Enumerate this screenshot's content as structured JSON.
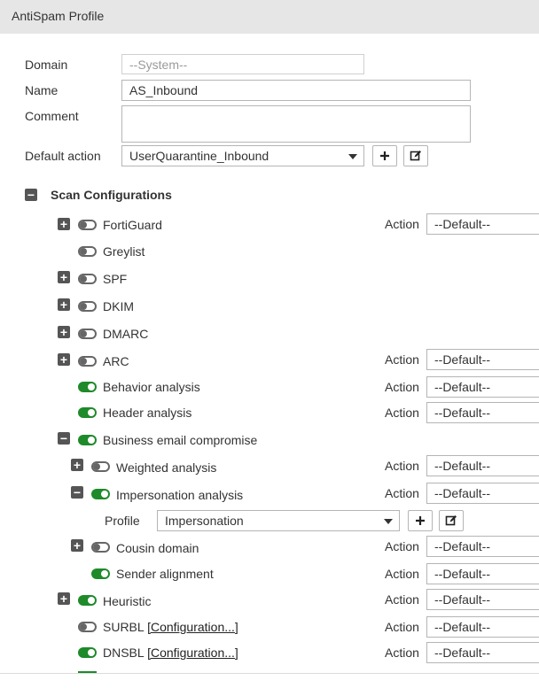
{
  "window": {
    "title": "AntiSpam Profile"
  },
  "form": {
    "domain_label": "Domain",
    "domain_value": "--System--",
    "name_label": "Name",
    "name_value": "AS_Inbound",
    "comment_label": "Comment",
    "comment_value": "",
    "default_action_label": "Default action",
    "default_action_value": "UserQuarantine_Inbound"
  },
  "section": {
    "title": "Scan Configurations",
    "action_label": "Action",
    "default_option": "--Default--"
  },
  "rows": [
    {
      "label": "FortiGuard",
      "enabled": false,
      "expander": "plus",
      "has_action": true
    },
    {
      "label": "Greylist",
      "enabled": false,
      "expander": "none",
      "has_action": false
    },
    {
      "label": "SPF",
      "enabled": false,
      "expander": "plus",
      "has_action": false
    },
    {
      "label": "DKIM",
      "enabled": false,
      "expander": "plus",
      "has_action": false
    },
    {
      "label": "DMARC",
      "enabled": false,
      "expander": "plus",
      "has_action": false
    },
    {
      "label": "ARC",
      "enabled": false,
      "expander": "plus",
      "has_action": true
    },
    {
      "label": "Behavior analysis",
      "enabled": true,
      "expander": "none",
      "has_action": true
    },
    {
      "label": "Header analysis",
      "enabled": true,
      "expander": "none",
      "has_action": true
    },
    {
      "label": "Business email compromise",
      "enabled": true,
      "expander": "minus",
      "has_action": false
    },
    {
      "label": "Weighted analysis",
      "enabled": false,
      "expander": "plus",
      "has_action": true
    },
    {
      "label": "Impersonation analysis",
      "enabled": true,
      "expander": "minus",
      "has_action": true
    },
    {
      "label": "Cousin domain",
      "enabled": false,
      "expander": "plus",
      "has_action": true
    },
    {
      "label": "Sender alignment",
      "enabled": true,
      "expander": "none",
      "has_action": true
    },
    {
      "label": "Heuristic",
      "enabled": true,
      "expander": "plus",
      "has_action": true
    },
    {
      "label": "SURBL",
      "link": "[Configuration...]",
      "enabled": false,
      "expander": "none",
      "has_action": true
    },
    {
      "label": "DNSBL",
      "link": "[Configuration...]",
      "enabled": true,
      "expander": "none",
      "has_action": true
    }
  ],
  "profile": {
    "label": "Profile",
    "value": "Impersonation"
  },
  "icons": {
    "add": "plus-icon",
    "edit": "edit-icon",
    "dropdown": "chevron-down-icon",
    "expand": "plus-square-icon",
    "collapse": "minus-square-icon"
  },
  "colors": {
    "toggle_on": "#1e8a2a",
    "toggle_off": "#666666",
    "titlebar": "#e6e6e6"
  }
}
